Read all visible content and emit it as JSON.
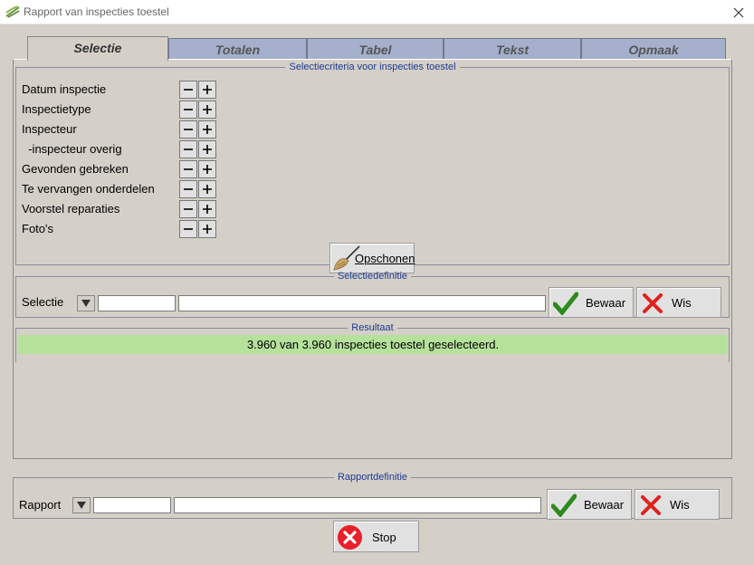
{
  "window": {
    "title": "Rapport van inspecties toestel"
  },
  "tabs": [
    {
      "label": "Selectie",
      "active": true
    },
    {
      "label": "Totalen"
    },
    {
      "label": "Tabel"
    },
    {
      "label": "Tekst"
    },
    {
      "label": "Opmaak"
    }
  ],
  "criteria": {
    "legend": "Selectiecriteria voor inspecties toestel",
    "items": [
      "Datum inspectie",
      "Inspectietype",
      "Inspecteur",
      "  -inspecteur overig",
      "Gevonden gebreken",
      "Te vervangen onderdelen",
      "Voorstel reparaties",
      "Foto's"
    ],
    "clear_label": "Opschonen"
  },
  "selectiedef": {
    "legend": "Selectiedefinitie",
    "label": "Selectie",
    "code_value": "",
    "name_value": "",
    "save_label": "Bewaar",
    "delete_label": "Wis"
  },
  "result": {
    "legend": "Resultaat",
    "text": "3.960 van 3.960 inspecties toestel geselecteerd.",
    "color": "#b5e19b"
  },
  "rapportdef": {
    "legend": "Rapportdefinitie",
    "label": "Rapport",
    "code_value": "",
    "name_value": "",
    "save_label": "Bewaar",
    "delete_label": "Wis"
  },
  "stop_label": "Stop"
}
